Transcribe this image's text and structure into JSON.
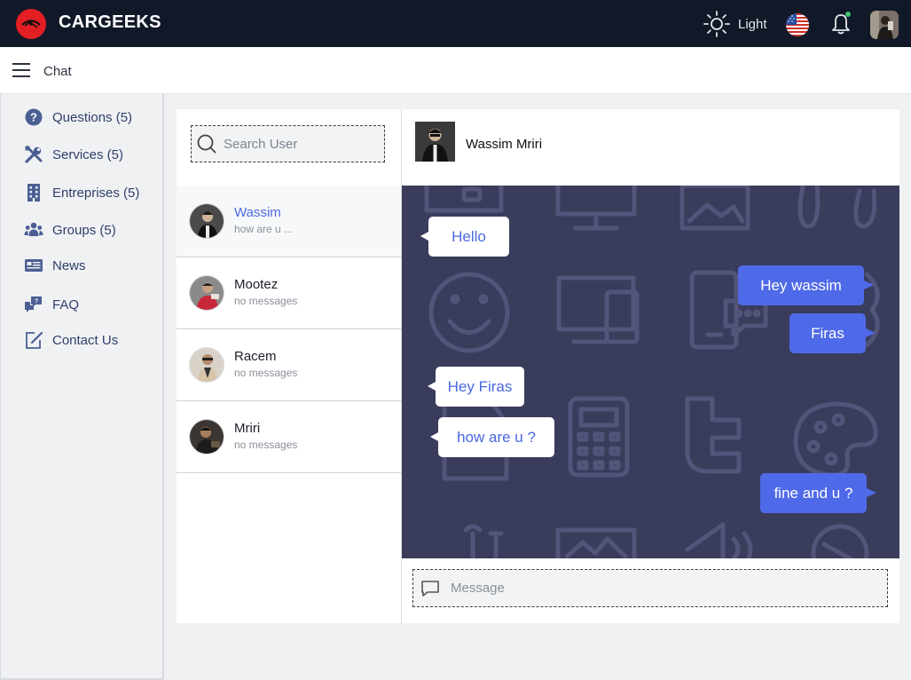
{
  "app": {
    "brand": "CARGEEKS"
  },
  "topbar": {
    "theme_label": "Light",
    "theme_icon": "sun-icon",
    "language_icon": "us-flag-icon",
    "notification_icon": "bell-icon",
    "accent_color": "#4f6ae8",
    "bar_color": "#111827"
  },
  "subheader": {
    "title": "Chat",
    "menu_icon": "hamburger-icon"
  },
  "sidebar": {
    "items": [
      {
        "label": "Questions (5)",
        "icon": "question-circle-icon"
      },
      {
        "label": "Services (5)",
        "icon": "tools-icon"
      },
      {
        "label": "Entreprises (5)",
        "icon": "building-icon"
      },
      {
        "label": "Groups (5)",
        "icon": "users-icon"
      },
      {
        "label": "News",
        "icon": "newspaper-icon"
      },
      {
        "label": "FAQ",
        "icon": "faq-chat-icon"
      },
      {
        "label": "Contact Us",
        "icon": "edit-square-icon"
      }
    ]
  },
  "search": {
    "placeholder": "Search User",
    "value": ""
  },
  "contacts": [
    {
      "name": "Wassim",
      "preview": "how are u ...",
      "active": true
    },
    {
      "name": "Mootez",
      "preview": "no messages",
      "active": false
    },
    {
      "name": "Racem",
      "preview": "no messages",
      "active": false
    },
    {
      "name": "Mriri",
      "preview": "no messages",
      "active": false
    }
  ],
  "conversation": {
    "name": "Wassim Mriri",
    "messages": [
      {
        "text": "Hello",
        "direction": "in"
      },
      {
        "text": "Hey wassim",
        "direction": "out"
      },
      {
        "text": "Firas",
        "direction": "out"
      },
      {
        "text": "Hey Firas",
        "direction": "in"
      },
      {
        "text": "how are u ?",
        "direction": "in"
      },
      {
        "text": "fine and u ?",
        "direction": "out"
      }
    ]
  },
  "composer": {
    "placeholder": "Message",
    "value": "",
    "icon": "message-bubble-icon"
  }
}
